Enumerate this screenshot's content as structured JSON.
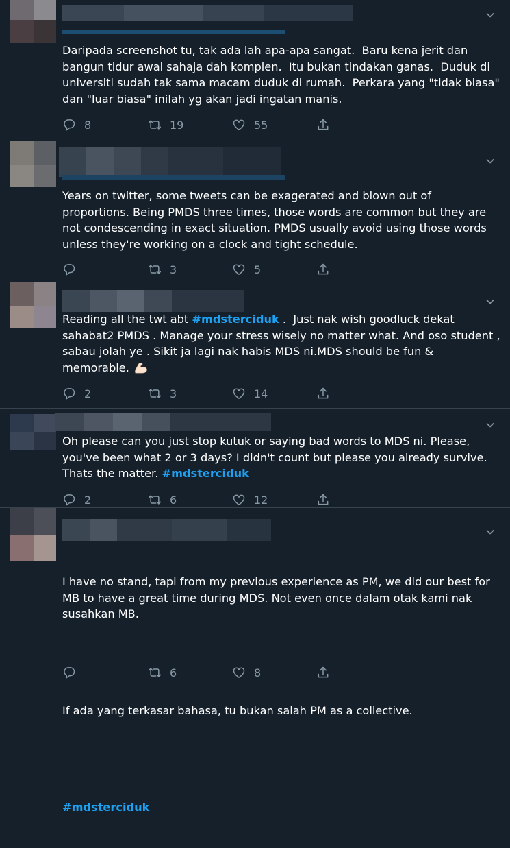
{
  "tweets": [
    {
      "paragraphs": [
        {
          "text": "Daripada screenshot tu, tak ada lah apa-apa sangat.  Baru kena jerit dan bangun tidur awal sahaja dah komplen.  Itu bukan tindakan ganas.  Duduk di universiti sudah tak sama macam duduk di rumah.  Perkara yang \"tidak biasa\" dan \"luar biasa\" inilah yg akan jadi ingatan manis."
        }
      ],
      "replies": "8",
      "retweets": "19",
      "likes": "55"
    },
    {
      "paragraphs": [
        {
          "text": "Years on twitter, some tweets can be exagerated and blown out of proportions. Being PMDS three times, those words are common but they are not condescending in exact situation. PMDS usually avoid using those words unless they're working on a clock and tight schedule."
        }
      ],
      "replies": "",
      "retweets": "3",
      "likes": "5"
    },
    {
      "pre": "Reading all the twt abt ",
      "hashtag": "#mdsterciduk",
      "post": " .  Just nak wish goodluck dekat sahabat2 PMDS . Manage your stress wisely no matter what. And oso student , sabau jolah ye . Sikit ja lagi nak habis MDS ni.MDS should be fun & memorable. ",
      "emoji": "flexed-biceps-emoji",
      "replies": "2",
      "retweets": "3",
      "likes": "14"
    },
    {
      "pre": "Oh please can you just stop kutuk or saying bad words to MDS ni. Please, you've been what 2 or 3 days? I didn't count but please you already survive. Thats the matter. ",
      "hashtag": "#mdsterciduk",
      "replies": "2",
      "retweets": "6",
      "likes": "12"
    },
    {
      "para1": "I have no stand, tapi from my previous experience as PM, we did our best for MB to have a great time during MDS. Not even once dalam otak kami nak susahkan MB.",
      "para2": "If ada yang terkasar bahasa, tu bukan salah PM as a collective.",
      "hashtag": "#mdsterciduk",
      "replies": "",
      "retweets": "6",
      "likes": "8"
    }
  ],
  "icons": {
    "reply": "reply-icon",
    "retweet": "retweet-icon",
    "like": "like-icon",
    "share": "share-icon",
    "more": "chevron-down-icon"
  },
  "colors": {
    "background": "#15202b",
    "text": "#ffffff",
    "muted": "#8899a6",
    "hashtag": "#1da1f2",
    "divider": "#38444d"
  }
}
